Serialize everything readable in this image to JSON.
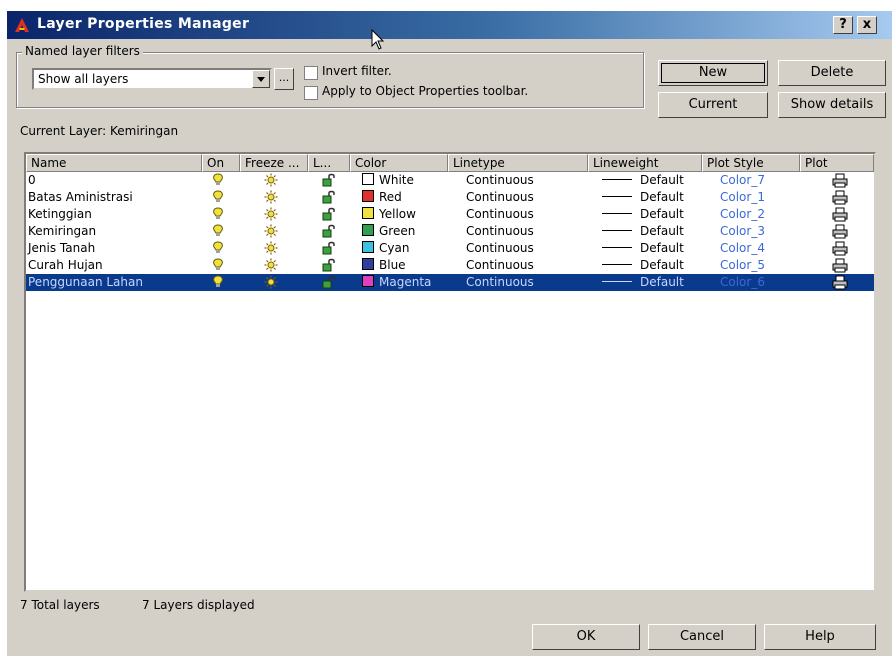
{
  "window": {
    "title": "Layer Properties Manager",
    "help_label": "?",
    "close_label": "x"
  },
  "filters": {
    "group_label": "Named layer filters",
    "selected": "Show all layers",
    "more_label": "...",
    "invert_label": "Invert filter.",
    "apply_label": "Apply to Object Properties toolbar."
  },
  "buttons": {
    "new": "New",
    "delete": "Delete",
    "current": "Current",
    "show_details": "Show details",
    "ok": "OK",
    "cancel": "Cancel",
    "help": "Help"
  },
  "current_layer": "Current Layer:  Kemiringan",
  "columns": [
    "Name",
    "On",
    "Freeze ...",
    "L...",
    "Color",
    "Linetype",
    "Lineweight",
    "Plot Style",
    "Plot"
  ],
  "layers": [
    {
      "name": "0",
      "color_name": "White",
      "color_hex": "#ffffff",
      "linetype": "Continuous",
      "lineweight": "Default",
      "plot_style": "Color_7"
    },
    {
      "name": "Batas Aministrasi",
      "color_name": "Red",
      "color_hex": "#e03030",
      "linetype": "Continuous",
      "lineweight": "Default",
      "plot_style": "Color_1"
    },
    {
      "name": "Ketinggian",
      "color_name": "Yellow",
      "color_hex": "#f0e040",
      "linetype": "Continuous",
      "lineweight": "Default",
      "plot_style": "Color_2"
    },
    {
      "name": "Kemiringan",
      "color_name": "Green",
      "color_hex": "#30a050",
      "linetype": "Continuous",
      "lineweight": "Default",
      "plot_style": "Color_3"
    },
    {
      "name": "Jenis Tanah",
      "color_name": "Cyan",
      "color_hex": "#40c0e0",
      "linetype": "Continuous",
      "lineweight": "Default",
      "plot_style": "Color_4"
    },
    {
      "name": "Curah Hujan",
      "color_name": "Blue",
      "color_hex": "#3040a0",
      "linetype": "Continuous",
      "lineweight": "Default",
      "plot_style": "Color_5"
    },
    {
      "name": "Penggunaan Lahan",
      "color_name": "Magenta",
      "color_hex": "#e040c0",
      "linetype": "Continuous",
      "lineweight": "Default",
      "plot_style": "Color_6",
      "selected": true
    }
  ],
  "status": {
    "total": "7 Total layers",
    "displayed": "7 Layers displayed"
  },
  "colors": {
    "title_start": "#0a246a",
    "title_end": "#a6caf0",
    "selection": "#0a3a8c",
    "dialog_face": "#d4d0c8",
    "plot_style_text": "#3a6ad8"
  }
}
